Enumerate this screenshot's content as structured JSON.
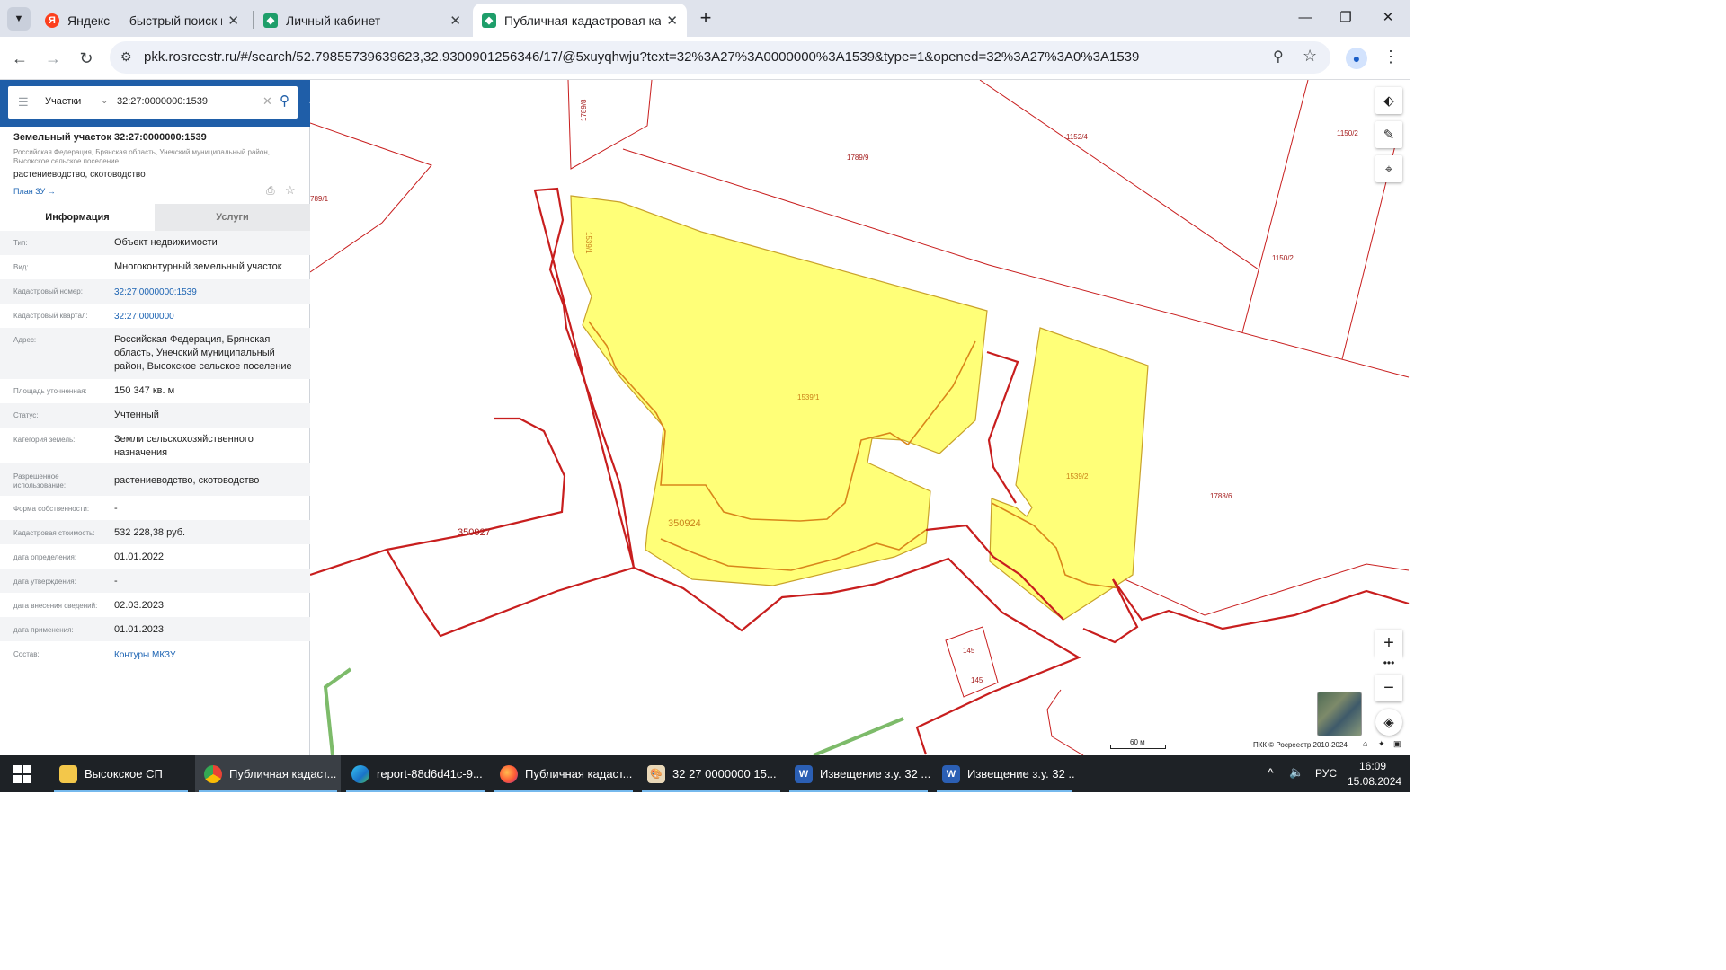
{
  "browser": {
    "tabs": [
      {
        "title": "Яндекс — быстрый поиск в интернете",
        "favicon": "yandex-icon",
        "color": "#fc3f1d"
      },
      {
        "title": "Личный кабинет",
        "favicon": "rosreestr-icon",
        "color": "#1e9e6a"
      },
      {
        "title": "Публичная кадастровая карта",
        "favicon": "rosreestr-icon",
        "color": "#1e9e6a"
      }
    ],
    "url": "pkk.rosreestr.ru/#/search/52.79855739639623,32.9300901256346/17/@5xuyqhwju?text=32%3A27%3A0000000%3A1539&type=1&opened=32%3A27%3A0%3A1539"
  },
  "panel": {
    "search": {
      "type_label": "Участки",
      "query": "32:27:0000000:1539"
    },
    "title": "Земельный участок 32:27:0000000:1539",
    "address_short": "Российская Федерация, Брянская область, Унечский муниципальный район, Высокское сельское поселение",
    "usage_short": "растениеводство, скотоводство",
    "plan_link": "План ЗУ →",
    "tabs": {
      "info": "Информация",
      "services": "Услуги"
    },
    "fields": [
      {
        "label": "Тип:",
        "value": "Объект недвижимости"
      },
      {
        "label": "Вид:",
        "value": "Многоконтурный земельный участок"
      },
      {
        "label": "Кадастровый номер:",
        "value": "32:27:0000000:1539",
        "link": true
      },
      {
        "label": "Кадастровый квартал:",
        "value": "32:27:0000000",
        "link": true
      },
      {
        "label": "Адрес:",
        "value": "Российская Федерация, Брянская область, Унечский муниципальный район, Высокское сельское поселение"
      },
      {
        "label": "Площадь уточненная:",
        "value": "150 347 кв. м"
      },
      {
        "label": "Статус:",
        "value": "Учтенный"
      },
      {
        "label": "Категория земель:",
        "value": "Земли сельскохозяйственного назначения"
      },
      {
        "label": "Разрешенное использование:",
        "value": "растениеводство, скотоводство"
      },
      {
        "label": "Форма собственности:",
        "value": "-"
      },
      {
        "label": "Кадастровая стоимость:",
        "value": "532 228,38 руб."
      },
      {
        "label": "дата определения:",
        "value": "01.01.2022"
      },
      {
        "label": "дата утверждения:",
        "value": "-"
      },
      {
        "label": "дата внесения сведений:",
        "value": "02.03.2023"
      },
      {
        "label": "дата применения:",
        "value": "01.01.2023"
      },
      {
        "label": "Состав:",
        "value": "Контуры МКЗУ",
        "link": true
      }
    ]
  },
  "map": {
    "parcel_labels": [
      "1789/8",
      "1152/4",
      "1150/2",
      "1789/9",
      "1150/2",
      "789/1",
      "1539/1",
      "1539/1",
      "1539/2",
      "1788/6",
      "350924",
      "350927",
      "145",
      "145"
    ],
    "scale_label": "60 м",
    "copyright": "ПКК © Росреестр 2010-2024",
    "colors": {
      "parcel_fill": "#ffff78",
      "parcel_stroke": "#d9861a",
      "boundary": "#c81e1e",
      "road": "#7dbb6a"
    }
  },
  "taskbar": {
    "items": [
      {
        "label": "Высокское СП",
        "icon": "folder-icon"
      },
      {
        "label": "Публичная кадаст...",
        "icon": "chrome-icon"
      },
      {
        "label": "report-88d6d41c-9...",
        "icon": "edge-icon"
      },
      {
        "label": "Публичная кадаст...",
        "icon": "firefox-icon"
      },
      {
        "label": "32  27  0000000  15...",
        "icon": "paint-icon"
      },
      {
        "label": "Извещение з.у. 32 ...",
        "icon": "word-icon"
      },
      {
        "label": "Извещение з.у. 32 ...",
        "icon": "word-icon"
      }
    ],
    "lang": "РУС",
    "time": "16:09",
    "date": "15.08.2024"
  }
}
